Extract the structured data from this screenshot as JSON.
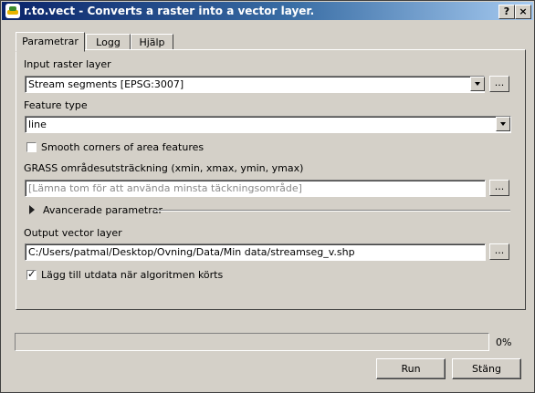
{
  "window": {
    "title": "r.to.vect - Converts a raster into a vector layer.",
    "help_label": "?",
    "close_label": "×"
  },
  "tabs": [
    {
      "label": "Parametrar",
      "active": true
    },
    {
      "label": "Logg",
      "active": false
    },
    {
      "label": "Hjälp",
      "active": false
    }
  ],
  "form": {
    "input_raster_label": "Input raster layer",
    "input_raster_value": "Stream segments [EPSG:3007]",
    "feature_type_label": "Feature type",
    "feature_type_value": "line",
    "smooth_corners_label": "Smooth corners of area features",
    "smooth_corners_checked": false,
    "region_label": "GRASS områdesutsträckning (xmin, xmax, ymin, ymax)",
    "region_placeholder": "[Lämna tom för att använda minsta täckningsområde]",
    "advanced_label": "Avancerade parametrar",
    "output_label": "Output vector layer",
    "output_value": "C:/Users/patmal/Desktop/Ovning/Data/Min data/streamseg_v.shp",
    "add_output_label": "Lägg till utdata när algoritmen körts",
    "add_output_checked": true,
    "browse_label": "..."
  },
  "progress": {
    "value": 0,
    "text": "0%"
  },
  "buttons": {
    "run": "Run",
    "close": "Stäng"
  },
  "colors": {
    "title_start": "#0a246a",
    "title_end": "#a6caf0",
    "face": "#d4d0c8"
  }
}
